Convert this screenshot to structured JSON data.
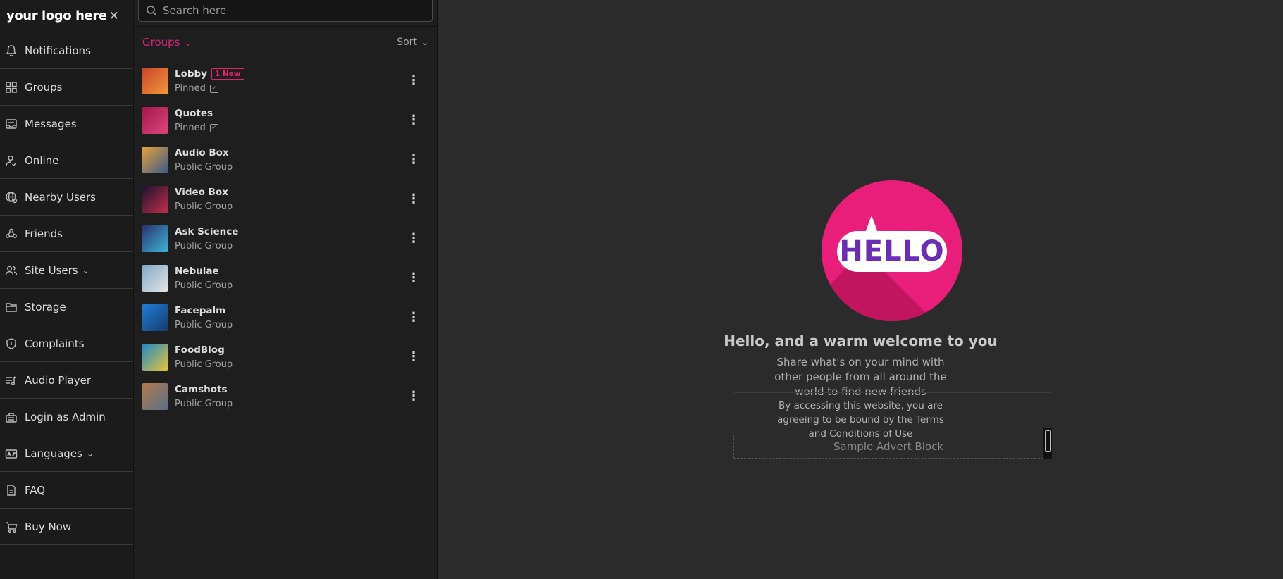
{
  "sidebar": {
    "logo": "your logo here",
    "close": "✕",
    "items": [
      {
        "label": "Notifications",
        "icon": "bell-icon"
      },
      {
        "label": "Groups",
        "icon": "grid-icon"
      },
      {
        "label": "Messages",
        "icon": "inbox-icon"
      },
      {
        "label": "Online",
        "icon": "user-check-icon"
      },
      {
        "label": "Nearby Users",
        "icon": "globe-icon"
      },
      {
        "label": "Friends",
        "icon": "friends-icon"
      },
      {
        "label": "Site Users",
        "icon": "users-icon",
        "chevron": "⌄"
      },
      {
        "label": "Storage",
        "icon": "folder-icon"
      },
      {
        "label": "Complaints",
        "icon": "shield-icon"
      },
      {
        "label": "Audio Player",
        "icon": "music-list-icon"
      },
      {
        "label": "Login as Admin",
        "icon": "keyboard-icon"
      },
      {
        "label": "Languages",
        "icon": "language-icon",
        "chevron": "⌄"
      },
      {
        "label": "FAQ",
        "icon": "document-icon"
      },
      {
        "label": "Buy Now",
        "icon": "cart-icon"
      }
    ]
  },
  "panel": {
    "search_placeholder": "Search here",
    "groups_label": "Groups",
    "sort_label": "Sort",
    "chevron": "⌄",
    "rows": [
      {
        "name": "Lobby",
        "badge": "1 New",
        "sub": "Pinned",
        "pinned": true,
        "color": "#c9422a",
        "color2": "#f29a3a"
      },
      {
        "name": "Quotes",
        "sub": "Pinned",
        "pinned": true,
        "color": "#a01848",
        "color2": "#e0457f"
      },
      {
        "name": "Audio Box",
        "sub": "Public Group",
        "color": "#e8a23a",
        "color2": "#3a5a8a"
      },
      {
        "name": "Video Box",
        "sub": "Public Group",
        "color": "#1a1030",
        "color2": "#c4304a"
      },
      {
        "name": "Ask Science",
        "sub": "Public Group",
        "color": "#2a2f6e",
        "color2": "#3fb8d8"
      },
      {
        "name": "Nebulae",
        "sub": "Public Group",
        "color": "#7ea7c6",
        "color2": "#e6e6e6"
      },
      {
        "name": "Facepalm",
        "sub": "Public Group",
        "color": "#1f7fd6",
        "color2": "#163a6e"
      },
      {
        "name": "FoodBlog",
        "sub": "Public Group",
        "color": "#1d88c8",
        "color2": "#e9c43a"
      },
      {
        "name": "Camshots",
        "sub": "Public Group",
        "color": "#b07a4a",
        "color2": "#5a6f86"
      }
    ]
  },
  "main": {
    "hello_text": "HELLO",
    "welcome_title": "Hello, and a warm welcome to you",
    "welcome_sub": "Share what's on your mind with other people from all around the world to find new friends",
    "terms": "By accessing this website, you are agreeing to be bound by the Terms and Conditions of Use",
    "advert": "Sample Advert Block"
  },
  "colors": {
    "accent": "#e91e7a",
    "hello_text": "#6a2db5",
    "badge": "#e0246e"
  }
}
